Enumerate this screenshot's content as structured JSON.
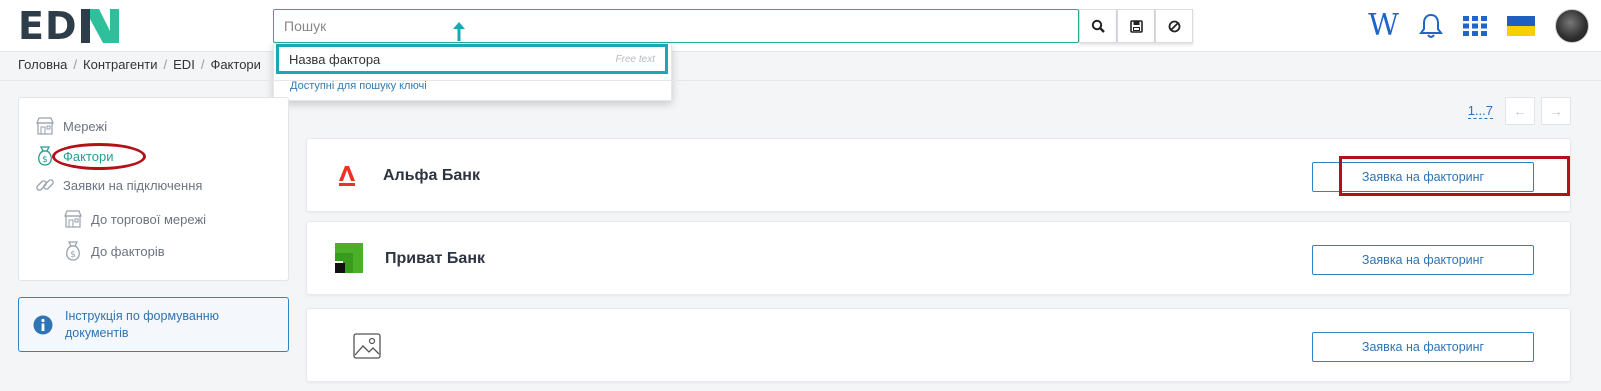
{
  "header": {
    "logo_left": "ED",
    "logo_right": "NI",
    "search": {
      "placeholder": "Пошук",
      "value": ""
    },
    "search_buttons": [
      "search-icon",
      "save-icon",
      "clear-icon"
    ],
    "wiki_label": "W",
    "icons": [
      "bell-icon",
      "apps-grid-icon",
      "ukraine-flag-icon",
      "avatar"
    ]
  },
  "search_dropdown": {
    "item_label": "Назва фактора",
    "item_hint": "Free text",
    "keys_link": "Доступні для пошуку ключі"
  },
  "breadcrumb": [
    "Головна",
    "Контрагенти",
    "EDI",
    "Фактори"
  ],
  "sidebar": {
    "items": [
      {
        "label": "Мережі",
        "icon": "store-icon",
        "active": false
      },
      {
        "label": "Фактори",
        "icon": "money-bag-icon",
        "active": true
      },
      {
        "label": "Заявки на підключення",
        "icon": "link-icon",
        "active": false
      }
    ],
    "subitems": [
      {
        "label": "До торгової мережі",
        "icon": "store-icon"
      },
      {
        "label": "До факторів",
        "icon": "money-bag-icon"
      }
    ]
  },
  "info_box": {
    "text": "Інструкція по формуванню документів"
  },
  "pager": {
    "range": "1...7"
  },
  "banks": [
    {
      "name": "Альфа Банк",
      "logo": "alfa-bank-logo",
      "button": "Заявка на факторинг"
    },
    {
      "name": "Приват Банк",
      "logo": "privat-bank-logo",
      "button": "Заявка на факторинг"
    },
    {
      "name": "",
      "logo": "image-placeholder-icon",
      "button": "Заявка на факторинг"
    }
  ],
  "colors": {
    "accent": "#23b09a",
    "link": "#2f74b5",
    "highlight": "#b31019",
    "alfa_red": "#ef3124",
    "privat_green": "#4caf2a"
  }
}
